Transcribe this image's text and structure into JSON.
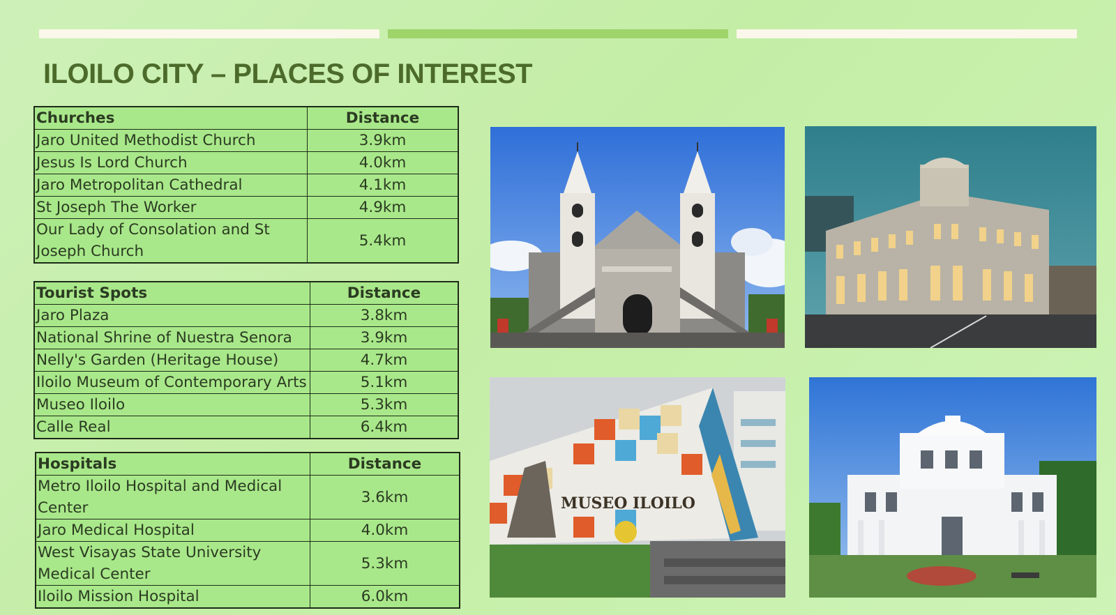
{
  "slide": {
    "title": "ILOILO CITY – PLACES OF INTEREST",
    "progress_segments": 3,
    "active_segment": 2,
    "colors": {
      "progress_active": "#9ed46a",
      "progress_inactive": "#fbf7ea",
      "title": "#4c6b2b",
      "table_fill": "#a9e88a"
    }
  },
  "tables": {
    "churches": {
      "header": "Churches",
      "dist_header": "Distance",
      "rows": [
        {
          "name": "Jaro United Methodist Church",
          "dist": "3.9km"
        },
        {
          "name": "Jesus Is Lord Church",
          "dist": "4.0km"
        },
        {
          "name": "Jaro Metropolitan Cathedral",
          "dist": "4.1km"
        },
        {
          "name": "St Joseph The Worker",
          "dist": "4.9km"
        },
        {
          "name": "Our Lady of Consolation and St Joseph Church",
          "dist": "5.4km"
        }
      ]
    },
    "tourist": {
      "header": "Tourist Spots",
      "dist_header": "Distance",
      "rows": [
        {
          "name": "Jaro Plaza",
          "dist": "3.8km"
        },
        {
          "name": "National Shrine of Nuestra Senora",
          "dist": "3.9km"
        },
        {
          "name": "Nelly's Garden (Heritage House)",
          "dist": "4.7km"
        },
        {
          "name": "Iloilo Museum of Contemporary Arts",
          "dist": "5.1km"
        },
        {
          "name": "Museo Iloilo",
          "dist": "5.3km"
        },
        {
          "name": "Calle Real",
          "dist": "6.4km"
        }
      ]
    },
    "hospitals": {
      "header": "Hospitals",
      "dist_header": "Distance",
      "rows": [
        {
          "name": "Metro Iloilo Hospital and Medical Center",
          "dist": "3.6km"
        },
        {
          "name": "Jaro Medical Hospital",
          "dist": "4.0km"
        },
        {
          "name": "West Visayas State University Medical Center",
          "dist": "5.3km"
        },
        {
          "name": "Iloilo Mission Hospital",
          "dist": "6.0km"
        }
      ]
    }
  },
  "photos": {
    "museum_sign": "MUSEO ILOILO"
  }
}
